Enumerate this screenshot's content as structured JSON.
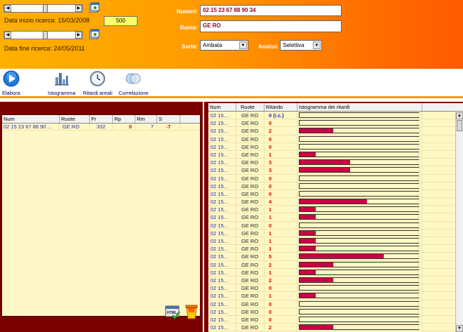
{
  "filters": {
    "data_inizio_label": "Data inizio ricerca:",
    "data_inizio_value": "15/03/2008",
    "data_fine_label": "Data fine ricerca:",
    "data_fine_value": "24/05/2011",
    "count_value": "500",
    "numeri_label": "Numeri:",
    "numeri_value": "02 15 23 67 88 90 34",
    "ruote_label": "Ruote:",
    "ruote_value": "GE RO",
    "sorte_label": "Sorte:",
    "sorte_value": "Ambata",
    "analisi_label": "Analisi:",
    "analisi_value": "Selettiva",
    "slider_start_position": 0.53,
    "slider_end_position": 0.53
  },
  "toolbar": {
    "elabora": "Elabora",
    "istogramma": "Istogramma",
    "ritardi_areali": "Ritardi areali",
    "correlazione": "Correlazione"
  },
  "left_table": {
    "headers": [
      "Num",
      "Ruote",
      "Fr",
      "Rp",
      "Rm",
      "S"
    ],
    "rows": [
      {
        "num": "02 15 23 67 88 90 ...",
        "ruote": "GE RO",
        "fr": "332",
        "rp": "0",
        "rm": "7",
        "s": "-7"
      }
    ]
  },
  "right_table": {
    "headers": [
      "Num",
      "Ruote",
      "Ritardo",
      "Istogramma dei ritardi"
    ],
    "max_ritardo": 7,
    "rows": [
      {
        "num": "02 15...",
        "ruote": "GE RO",
        "ritardo": "0 (i.c.)",
        "value": 0
      },
      {
        "num": "02 15...",
        "ruote": "GE RO",
        "ritardo": "0",
        "value": 0
      },
      {
        "num": "02 15...",
        "ruote": "GE RO",
        "ritardo": "2",
        "value": 2
      },
      {
        "num": "02 15...",
        "ruote": "GE RO",
        "ritardo": "0",
        "value": 0
      },
      {
        "num": "02 15...",
        "ruote": "GE RO",
        "ritardo": "0",
        "value": 0
      },
      {
        "num": "02 15...",
        "ruote": "GE RO",
        "ritardo": "1",
        "value": 1
      },
      {
        "num": "02 15...",
        "ruote": "GE RO",
        "ritardo": "3",
        "value": 3
      },
      {
        "num": "02 15...",
        "ruote": "GE RO",
        "ritardo": "3",
        "value": 3
      },
      {
        "num": "02 15...",
        "ruote": "GE RO",
        "ritardo": "0",
        "value": 0
      },
      {
        "num": "02 15...",
        "ruote": "GE RO",
        "ritardo": "0",
        "value": 0
      },
      {
        "num": "02 15...",
        "ruote": "GE RO",
        "ritardo": "0",
        "value": 0
      },
      {
        "num": "02 15...",
        "ruote": "GE RO",
        "ritardo": "4",
        "value": 4
      },
      {
        "num": "02 15...",
        "ruote": "GE RO",
        "ritardo": "1",
        "value": 1
      },
      {
        "num": "02 15...",
        "ruote": "GE RO",
        "ritardo": "1",
        "value": 1
      },
      {
        "num": "02 15...",
        "ruote": "GE RO",
        "ritardo": "0",
        "value": 0
      },
      {
        "num": "02 15...",
        "ruote": "GE RO",
        "ritardo": "1",
        "value": 1
      },
      {
        "num": "02 15...",
        "ruote": "GE RO",
        "ritardo": "1",
        "value": 1
      },
      {
        "num": "02 15...",
        "ruote": "GE RO",
        "ritardo": "1",
        "value": 1
      },
      {
        "num": "02 15...",
        "ruote": "GE RO",
        "ritardo": "5",
        "value": 5
      },
      {
        "num": "02 15...",
        "ruote": "GE RO",
        "ritardo": "2",
        "value": 2
      },
      {
        "num": "02 15...",
        "ruote": "GE RO",
        "ritardo": "1",
        "value": 1
      },
      {
        "num": "02 15...",
        "ruote": "GE RO",
        "ritardo": "2",
        "value": 2
      },
      {
        "num": "02 15...",
        "ruote": "GE RO",
        "ritardo": "0",
        "value": 0
      },
      {
        "num": "02 15...",
        "ruote": "GE RO",
        "ritardo": "1",
        "value": 1
      },
      {
        "num": "02 15...",
        "ruote": "GE RO",
        "ritardo": "0",
        "value": 0
      },
      {
        "num": "02 15...",
        "ruote": "GE RO",
        "ritardo": "0",
        "value": 0
      },
      {
        "num": "02 15...",
        "ruote": "GE RO",
        "ritardo": "0",
        "value": 0
      },
      {
        "num": "02 15...",
        "ruote": "GE RO",
        "ritardo": "2",
        "value": 2
      }
    ]
  },
  "colors": {
    "bar": "#cc0044",
    "panel_dark": "#7a0000",
    "grid_bg": "#fff8c6",
    "accent_orange": "#ff9a00"
  },
  "icons": [
    "calendar-icon",
    "play-icon",
    "histogram-icon",
    "clock-icon",
    "correlation-icon",
    "html-export-icon",
    "trash-bin-icon"
  ]
}
